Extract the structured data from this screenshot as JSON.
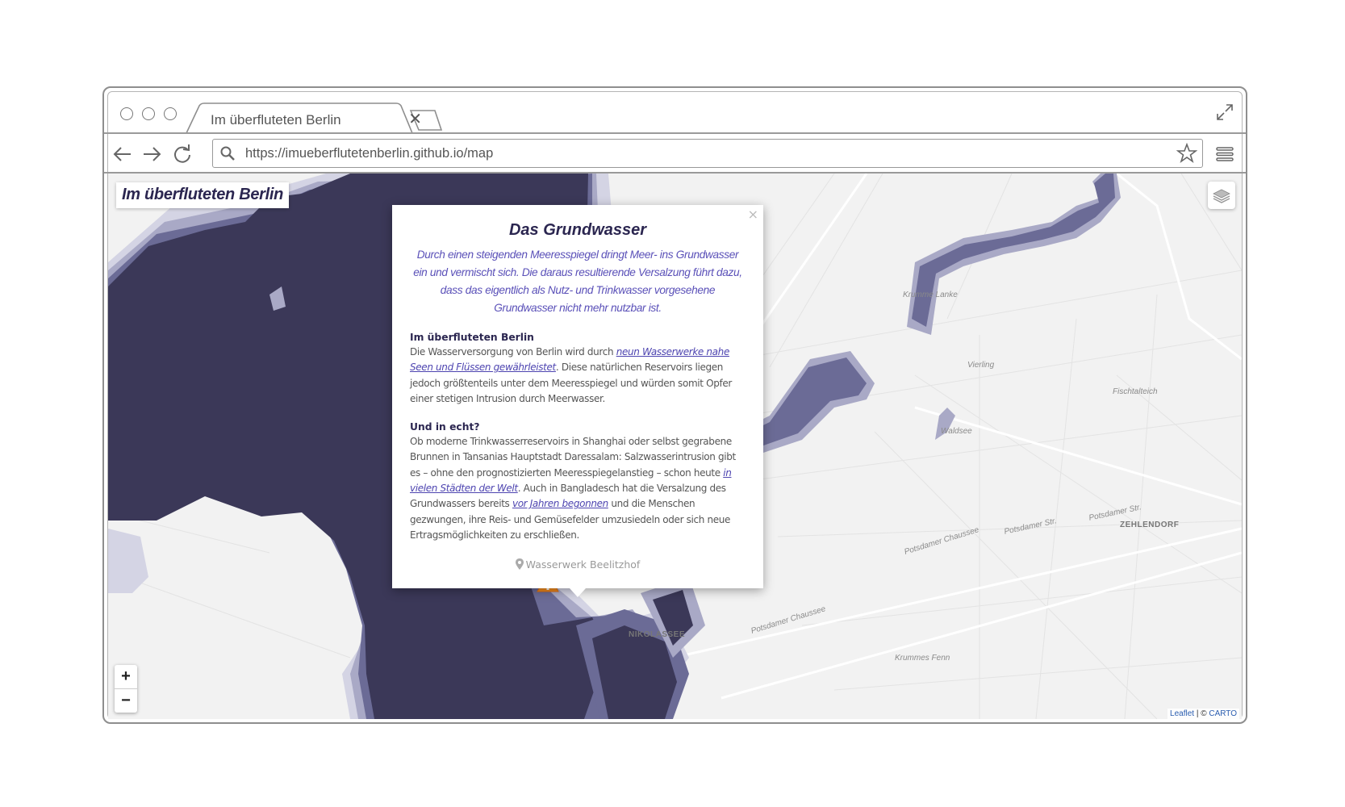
{
  "browser": {
    "tab_title": "Im überfluteten Berlin",
    "tab_close": "✕",
    "url": "https://imueberflutetenberlin.github.io/map"
  },
  "map": {
    "title": "Im überfluteten Berlin",
    "zoom_in": "+",
    "zoom_out": "−",
    "attribution": {
      "leaflet": "Leaflet",
      "sep": " | © ",
      "carto": "CARTO"
    },
    "labels": {
      "district_1": "NIKOLASSEE",
      "district_2": "ZEHLENDORF",
      "road_1": "Potsdamer Chaussee",
      "road_2": "Potsdamer Chaussee",
      "road_3": "Potsdamer Str.",
      "road_4": "Potsdamer Str.",
      "lake_1": "Krumme Lanke",
      "lake_2": "Vierling",
      "lake_3": "Waldsee",
      "lake_4": "Fischtalteich",
      "lake_5": "Krummes Fenn"
    },
    "colors": {
      "water": "#3b3858",
      "flood_1": "#6b6b96",
      "flood_2": "#a9a9c6",
      "flood_3": "#d4d4e4",
      "land": "#f2f2f2",
      "warning": "#f08a1c"
    }
  },
  "popup": {
    "close": "×",
    "title": "Das Grundwasser",
    "lead": "Durch einen steigenden Meeresspiegel dringt Meer- ins Grundwasser ein und vermischt sich. Die daraus resultierende Versalzung führt dazu, dass das eigentlich als Nutz- und Trinkwasser vorgesehene Grundwasser nicht mehr nutzbar ist.",
    "section1": {
      "heading": "Im überfluteten Berlin",
      "text_a": "Die Wasserversorgung von Berlin wird durch ",
      "link": "neun Wasserwerke nahe Seen und Flüssen gewährleistet",
      "text_b": ". Diese natürlichen Reservoirs liegen jedoch größtenteils unter dem Meeresspiegel und würden somit Opfer einer stetigen Intrusion durch Meerwasser."
    },
    "section2": {
      "heading": "Und in echt?",
      "text_a": "Ob moderne Trinkwasserreservoirs in Shanghai oder selbst gegrabene Brunnen in Tansanias Hauptstadt Daressalam: Salzwasserintrusion gibt es – ohne den prognostizierten Meeresspiegelanstieg – schon heute ",
      "link1": "in vielen Städten der Welt",
      "text_b": ". Auch in Bangladesch hat die Versalzung des Grundwassers bereits ",
      "link2": "vor Jahren begonnen",
      "text_c": " und die Menschen gezwungen, ihre Reis- und Gemüsefelder umzusiedeln oder sich neue Ertragsmöglichkeiten zu erschließen."
    },
    "location": "Wasserwerk Beelitzhof"
  }
}
